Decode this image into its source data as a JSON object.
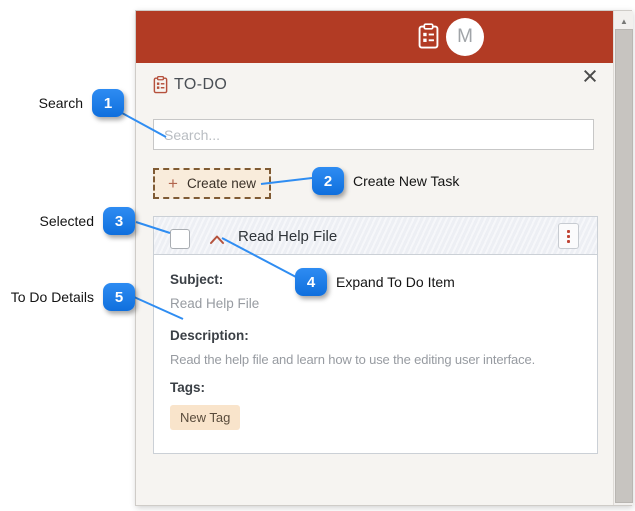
{
  "header": {
    "avatar_initial": "M"
  },
  "panel": {
    "title": "TO-DO",
    "search_placeholder": "Search...",
    "create_plus": "+",
    "create_label": "Create new"
  },
  "task": {
    "title": "Read Help File",
    "subject_label": "Subject:",
    "subject": "Read Help File",
    "description_label": "Description:",
    "description": "Read the help file and learn how to use the editing user interface.",
    "tags_label": "Tags:",
    "tag": "New Tag"
  },
  "icons": {
    "close": "×",
    "scroll_up": "▲"
  },
  "annotations": [
    {
      "number": "1",
      "label": "Search"
    },
    {
      "number": "2",
      "label": "Create New Task"
    },
    {
      "number": "3",
      "label": "Selected"
    },
    {
      "number": "4",
      "label": "Expand To Do Item"
    },
    {
      "number": "5",
      "label": "To Do Details"
    }
  ],
  "colors": {
    "header_red": "#b23b24",
    "badge_blue": "#1b7ce9",
    "connector_blue": "#2f8df2",
    "tag_bg": "#f9e4cb",
    "accent_brown": "#b5503c"
  }
}
